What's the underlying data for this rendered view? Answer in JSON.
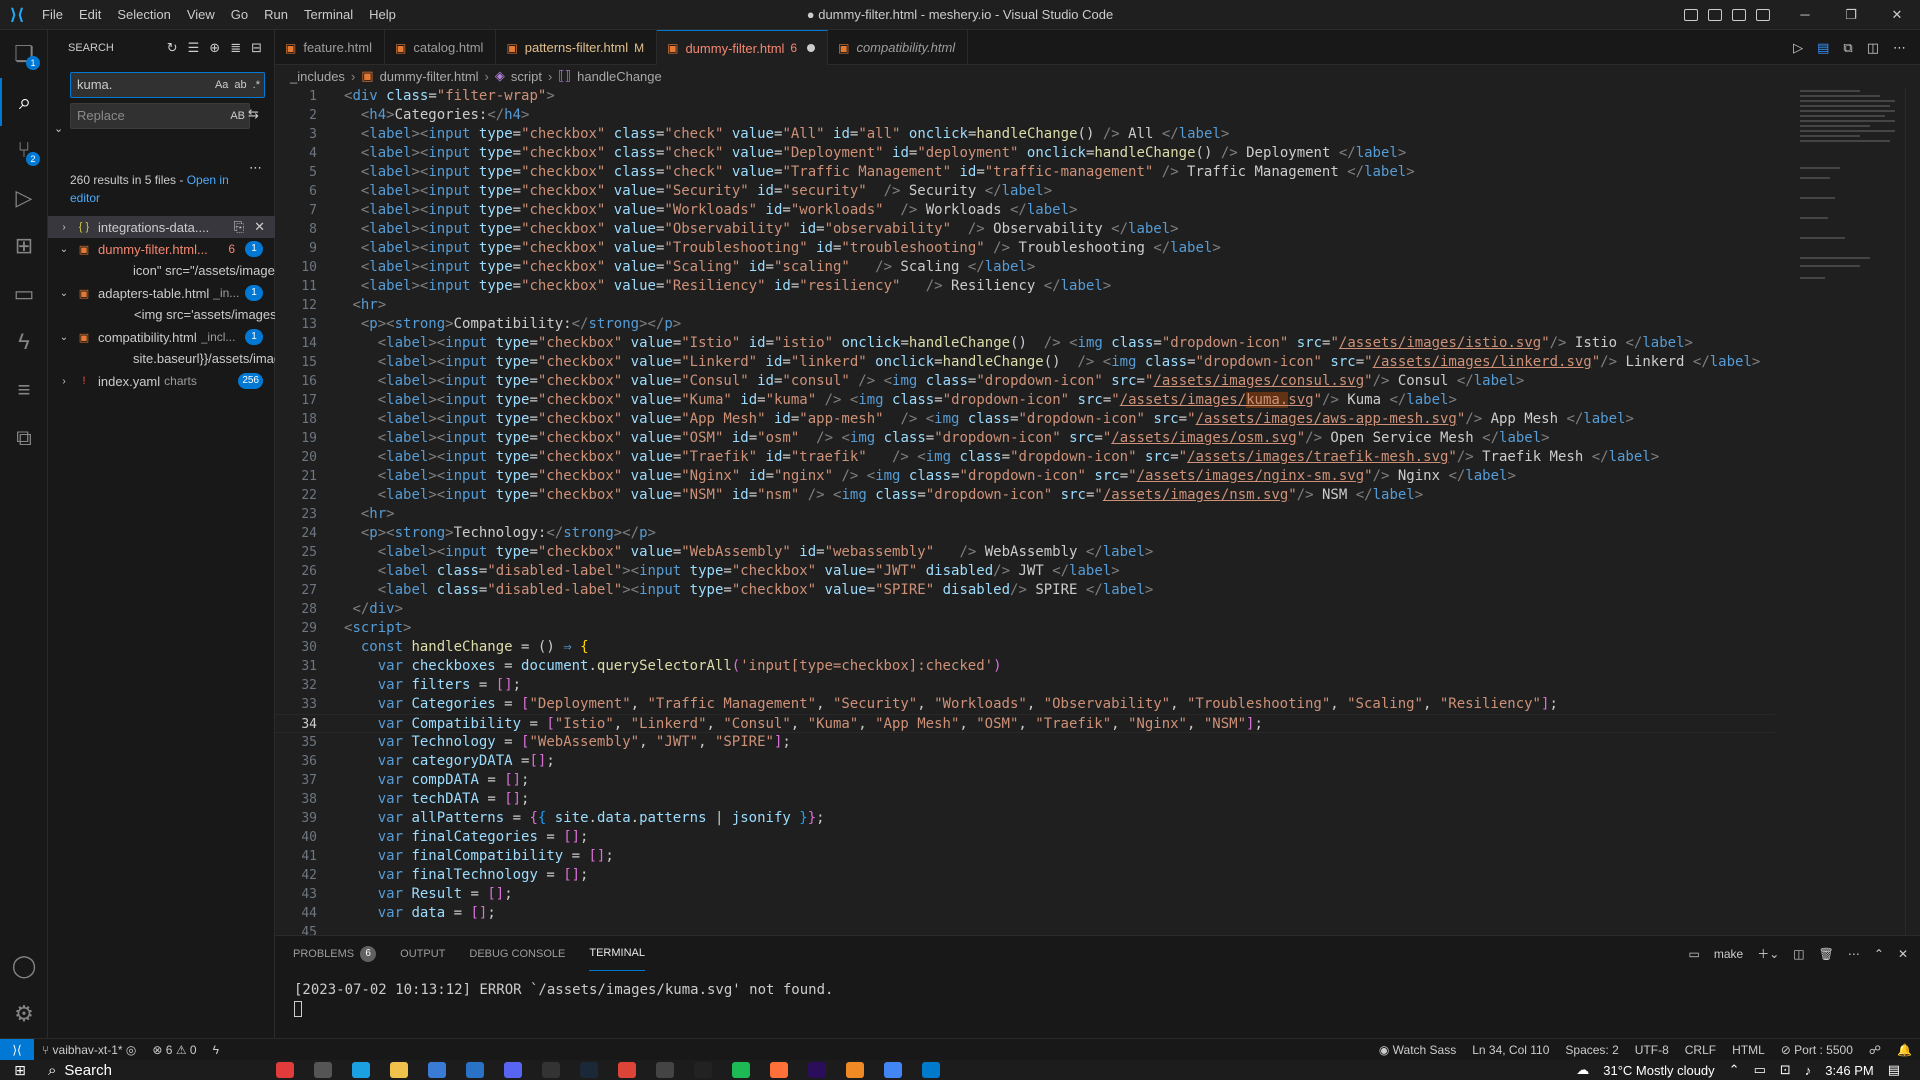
{
  "window": {
    "title": "● dummy-filter.html - meshery.io - Visual Studio Code",
    "menu": [
      "File",
      "Edit",
      "Selection",
      "View",
      "Go",
      "Run",
      "Terminal",
      "Help"
    ]
  },
  "activity": {
    "explorer_badge": "1",
    "scm_badge": "2"
  },
  "sidebar": {
    "title": "SEARCH",
    "search_value": "kuma.",
    "search_opts": [
      "Aa",
      "ab",
      ".*"
    ],
    "replace_placeholder": "Replace",
    "replace_opt": "AB",
    "results_text": "260 results in 5 files - ",
    "open_in_editor": "Open in editor",
    "files": [
      {
        "name": "integrations-data....",
        "desc": "",
        "count": "",
        "expanded": false,
        "kind": "json"
      },
      {
        "name": "dummy-filter.html...",
        "desc": "",
        "errors": "6",
        "count": "1",
        "expanded": true,
        "kind": "html",
        "matches": [
          "icon\" src=\"/assets/images/ku..."
        ]
      },
      {
        "name": "adapters-table.html",
        "desc": "_in...",
        "count": "1",
        "expanded": true,
        "kind": "html",
        "matches": [
          "<img src='assets/images/kum..."
        ]
      },
      {
        "name": "compatibility.html",
        "desc": "_incl...",
        "count": "1",
        "expanded": true,
        "kind": "html",
        "matches": [
          "site.baseurl}}/assets/images/ku..."
        ]
      },
      {
        "name": "index.yaml",
        "desc": "charts",
        "count": "256",
        "expanded": false,
        "kind": "yaml"
      }
    ]
  },
  "tabs": [
    {
      "name": "feature.html",
      "state": "",
      "style": ""
    },
    {
      "name": "catalog.html",
      "state": "",
      "style": ""
    },
    {
      "name": "patterns-filter.html",
      "state": "M",
      "style": "mod"
    },
    {
      "name": "dummy-filter.html",
      "state": "6",
      "style": "err",
      "active": true,
      "dirty": true
    },
    {
      "name": "compatibility.html",
      "state": "",
      "style": "italic"
    }
  ],
  "breadcrumbs": [
    "_includes",
    "dummy-filter.html",
    "script",
    "handleChange"
  ],
  "editor": {
    "current_line": 34,
    "start_line": 1
  },
  "panel": {
    "tabs": [
      "PROBLEMS",
      "OUTPUT",
      "DEBUG CONSOLE",
      "TERMINAL"
    ],
    "problems_count": "6",
    "active": "TERMINAL",
    "terminal_name": "make",
    "terminal_output": "[2023-07-02 10:13:12] ERROR `/assets/images/kuma.svg' not found."
  },
  "status": {
    "branch": "vaibhav-xt-1*",
    "errors": "6",
    "warnings": "0",
    "watch_sass": "Watch Sass",
    "position": "Ln 34, Col 110",
    "spaces": "Spaces: 2",
    "encoding": "UTF-8",
    "eol": "CRLF",
    "language": "HTML",
    "port": "Port : 5500"
  },
  "taskbar": {
    "search_label": "Search",
    "weather": "31°C  Mostly cloudy",
    "time": "3:46 PM"
  },
  "colors": {
    "accent": "#0078d4",
    "error": "#f48771",
    "modified": "#e2c08d"
  }
}
